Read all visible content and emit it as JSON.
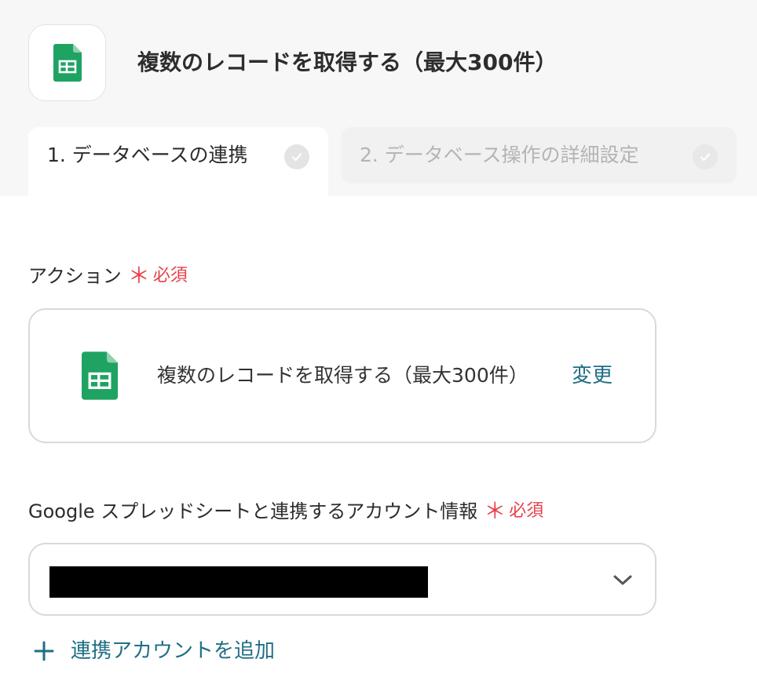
{
  "header": {
    "title": "複数のレコードを取得する（最大300件）",
    "app_icon": "google-sheets-icon"
  },
  "tabs": [
    {
      "label": "1. データベースの連携",
      "status": "check-icon"
    },
    {
      "label": "2. データベース操作の詳細設定",
      "status": "check-icon"
    }
  ],
  "action_field": {
    "label": "アクション",
    "required_mark": "＊",
    "required_text": "必須",
    "selected_action": "複数のレコードを取得する（最大300件）",
    "change_label": "変更"
  },
  "account_field": {
    "label": "Google スプレッドシートと連携するアカウント情報",
    "required_mark": "＊",
    "required_text": "必須",
    "add_label": "連携アカウントを追加"
  },
  "colors": {
    "accent": "#1f6f86",
    "required": "#e8404a",
    "sheets_green": "#1ea362"
  }
}
